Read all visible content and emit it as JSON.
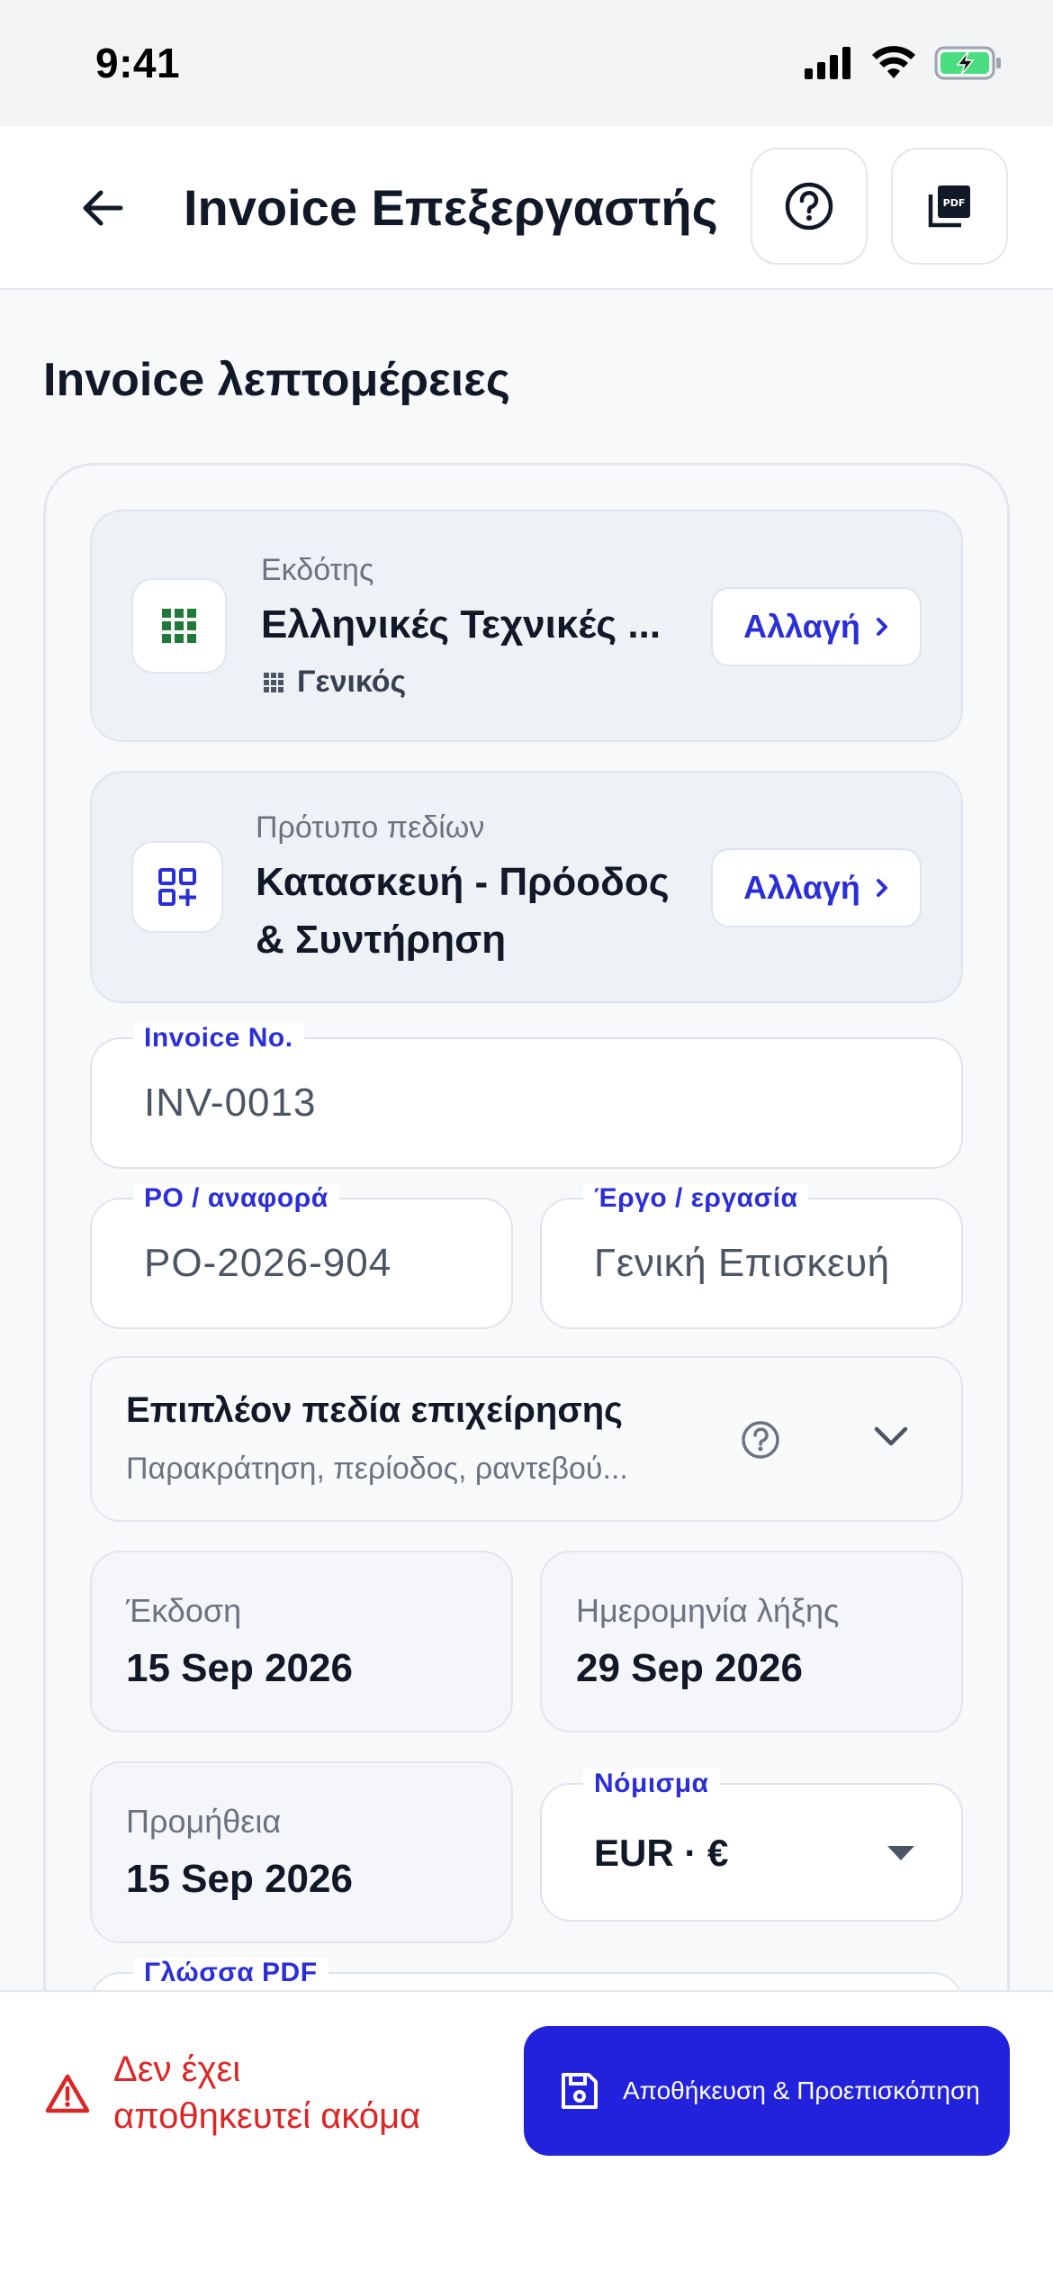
{
  "status": {
    "time": "9:41"
  },
  "header": {
    "title": "Invoice Επεξεργαστής"
  },
  "section": {
    "title": "Invoice λεπτομέρειες"
  },
  "issuer": {
    "caption": "Εκδότης",
    "name": "Ελληνικές Τεχνικές ...",
    "category": "Γενικός",
    "change_label": "Αλλαγή"
  },
  "template": {
    "caption": "Πρότυπο πεδίων",
    "name_line1": "Κατασκευή - Πρόοδος",
    "name_line2": "& Συντήρηση",
    "change_label": "Αλλαγή"
  },
  "fields": {
    "invoice_no": {
      "label": "Invoice No.",
      "value": "INV-0013"
    },
    "po_ref": {
      "label": "PO / αναφορά",
      "value": "PO-2026-904"
    },
    "project": {
      "label": "Έργο / εργασία",
      "value": "Γενική Επισκευή"
    }
  },
  "more_fields": {
    "title": "Επιπλέον πεδία επιχείρησης",
    "subtitle": "Παρακράτηση, περίοδος, ραντεβού..."
  },
  "dates": {
    "issue": {
      "caption": "Έκδοση",
      "value": "15 Sep 2026"
    },
    "due": {
      "caption": "Ημερομηνία λήξης",
      "value": "29 Sep 2026"
    },
    "supply": {
      "caption": "Προμήθεια",
      "value": "15 Sep 2026"
    }
  },
  "currency": {
    "label": "Νόμισμα",
    "value": "EUR · €"
  },
  "pdf_language": {
    "label": "Γλώσσα PDF"
  },
  "footer": {
    "warning_line1": "Δεν έχει",
    "warning_line2": "αποθηκευτεί ακόμα",
    "save_label": "Αποθήκευση & Προεπισκόπηση"
  },
  "colors": {
    "accent": "#2222dd",
    "warning": "#dc2626",
    "issuer_icon": "#1f7a3a"
  },
  "icons": {
    "back": "arrow-left-icon",
    "help": "question-circle-icon",
    "pdf": "pdf-icon",
    "issuer": "grid-icon",
    "template": "grid-plus-icon",
    "chevron": "chevron-right-icon",
    "expand": "chevron-down-icon",
    "dropdown": "caret-down-icon",
    "warning": "warning-triangle-icon",
    "save": "floppy-disk-icon"
  }
}
